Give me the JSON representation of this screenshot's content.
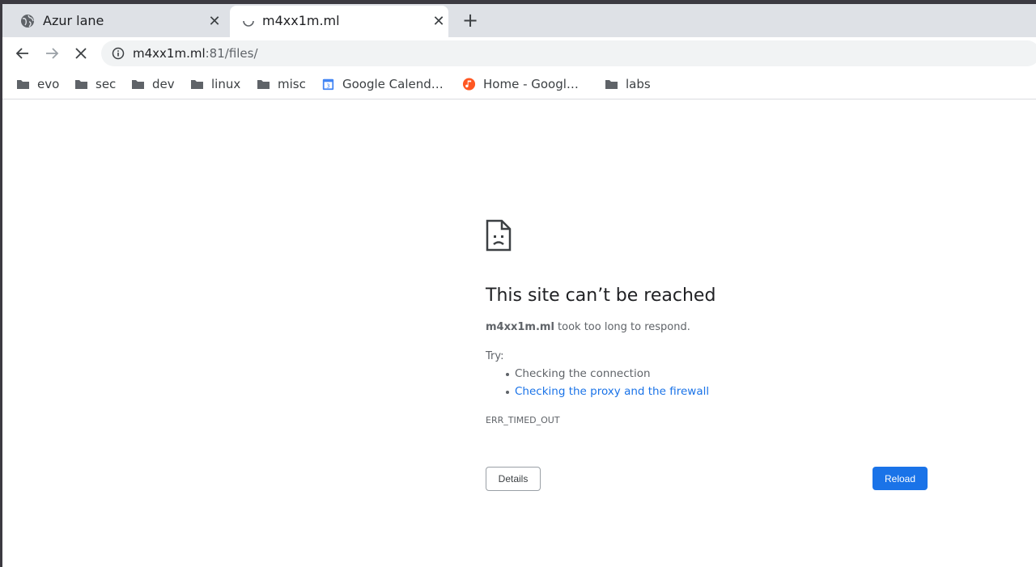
{
  "tabs": [
    {
      "title": "Azur lane",
      "icon": "globe-icon",
      "state": "inactive"
    },
    {
      "title": "m4xx1m.ml",
      "icon": "loading-spinner-icon",
      "state": "active"
    }
  ],
  "toolbar": {
    "url_host": "m4xx1m.ml",
    "url_rest": ":81/files/"
  },
  "bookmarks": [
    {
      "label": "evo",
      "icon": "folder-icon"
    },
    {
      "label": "sec",
      "icon": "folder-icon"
    },
    {
      "label": "dev",
      "icon": "folder-icon"
    },
    {
      "label": "linux",
      "icon": "folder-icon"
    },
    {
      "label": "misc",
      "icon": "folder-icon"
    },
    {
      "label": "Google Calend…",
      "icon": "google-calendar-icon"
    },
    {
      "label": "Home - Googl…",
      "icon": "google-play-music-icon"
    },
    {
      "label": "labs",
      "icon": "folder-icon"
    }
  ],
  "error": {
    "title": "This site can’t be reached",
    "host": "m4xx1m.ml",
    "description_suffix": " took too long to respond.",
    "try_label": "Try:",
    "suggestions": [
      {
        "text": "Checking the connection"
      },
      {
        "text": "Checking the proxy and the firewall"
      }
    ],
    "code": "ERR_TIMED_OUT",
    "details_label": "Details",
    "reload_label": "Reload"
  },
  "colors": {
    "accent": "#1a73e8",
    "tabstrip": "#dee1e6",
    "text_secondary": "#5f6368"
  }
}
